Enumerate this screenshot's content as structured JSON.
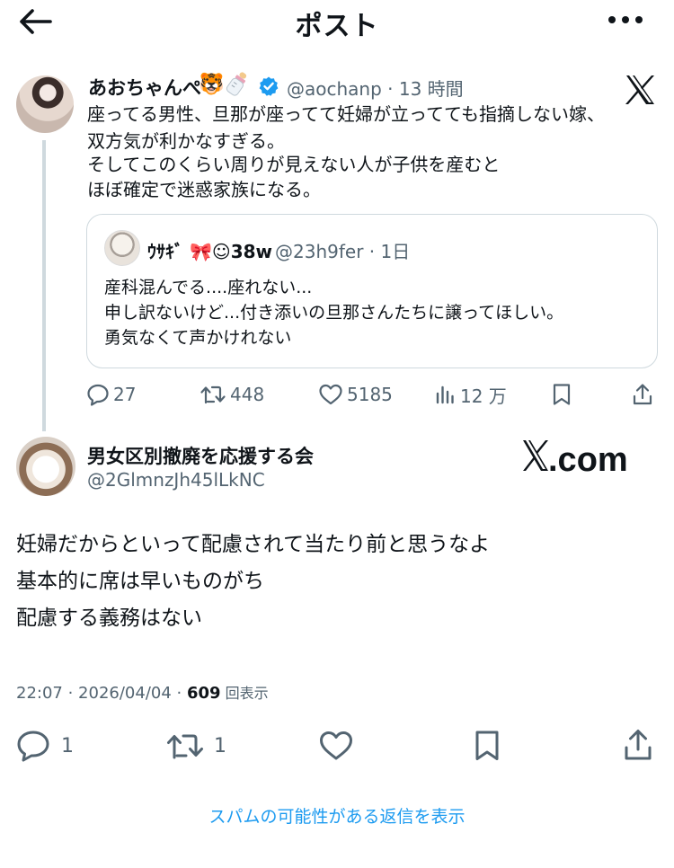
{
  "header": {
    "title": "ポスト"
  },
  "parent_post": {
    "author_name": "あおちゃんぺ",
    "author_emoji_1": "🐯",
    "author_emoji_2": "baby-bottle",
    "handle_and_time": "@aochanp · 13 時間",
    "text_lines": [
      "座ってる男性、旦那が座ってて妊婦が立ってても指摘しない嫁、",
      "双方気が利かなすぎる。",
      "そしてこのくらい周りが見えない人が子供を産むと",
      "ほぼ確定で迷惑家族になる。"
    ],
    "quote": {
      "author_name": "ｳｻｷﾞ 🎀☺38w",
      "handle_and_time": "@23h9fer · 1日",
      "text_lines": [
        "産科混んでる....座れない...",
        "申し訳ないけど...付き添いの旦那さんたちに譲ってほしい。",
        "勇気なくて声かけれない"
      ]
    },
    "actions": {
      "replies": "27",
      "reposts": "448",
      "likes": "5185",
      "views": "12 万"
    }
  },
  "main_post": {
    "author_name": "男女区別撤廃を応援する会",
    "handle": "@2GlmnzJh45lLkNC",
    "xcom_label": "X.com",
    "text_lines": [
      "妊婦だからといって配慮されて当たり前と思うなよ",
      "基本的に席は早いものがち",
      "配慮する義務はない"
    ],
    "meta_time": "22:07 · 2026/04/04 · ",
    "views_count": "609",
    "views_label": " 回表示",
    "actions": {
      "replies": "1",
      "reposts": "1"
    }
  },
  "spam_link": "スパムの可能性がある返信を表示",
  "colors": {
    "accent": "#1d9bf0",
    "text": "#0f1419",
    "muted": "#536471",
    "border": "#cfd9de"
  }
}
